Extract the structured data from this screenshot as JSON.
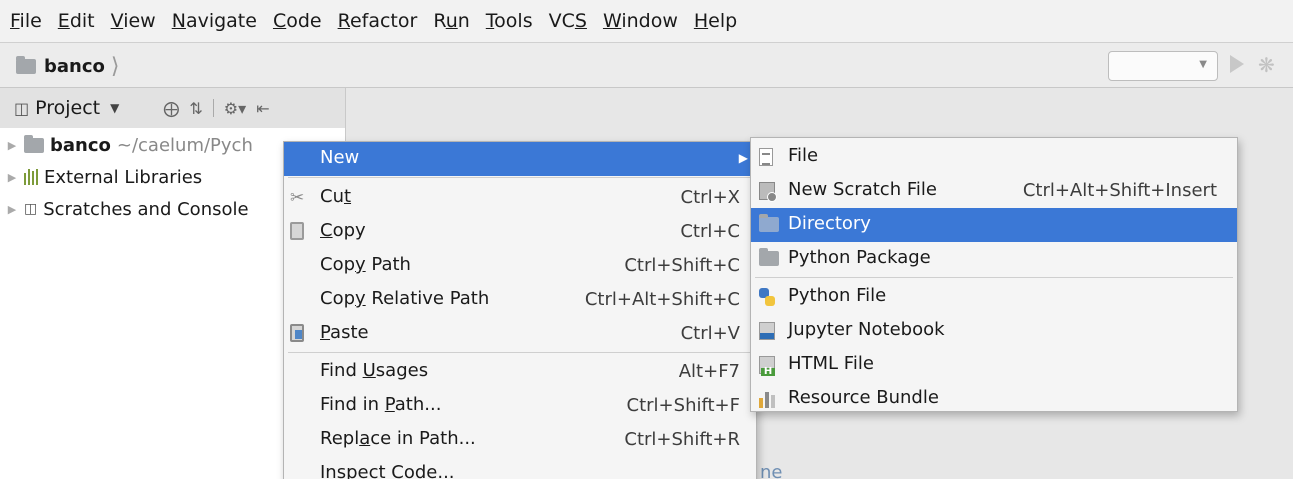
{
  "menubar": {
    "items": [
      {
        "pre": "",
        "u": "F",
        "post": "ile"
      },
      {
        "pre": "",
        "u": "E",
        "post": "dit"
      },
      {
        "pre": "",
        "u": "V",
        "post": "iew"
      },
      {
        "pre": "",
        "u": "N",
        "post": "avigate"
      },
      {
        "pre": "",
        "u": "C",
        "post": "ode"
      },
      {
        "pre": "",
        "u": "R",
        "post": "efactor"
      },
      {
        "pre": "R",
        "u": "u",
        "post": "n"
      },
      {
        "pre": "",
        "u": "T",
        "post": "ools"
      },
      {
        "pre": "VC",
        "u": "S",
        "post": ""
      },
      {
        "pre": "",
        "u": "W",
        "post": "indow"
      },
      {
        "pre": "",
        "u": "H",
        "post": "elp"
      }
    ]
  },
  "navbar": {
    "breadcrumb": "banco"
  },
  "project_panel": {
    "title": "Project",
    "tree": [
      {
        "name": "banco",
        "path": "~/caelum/Pych",
        "icon": "folder-icon"
      },
      {
        "name": "External Libraries",
        "icon": "libraries-icon"
      },
      {
        "name": "Scratches and Console",
        "icon": "scratches-icon"
      }
    ]
  },
  "editor": {
    "hint_fragment": "ne"
  },
  "context_menu": {
    "items": [
      {
        "pre": "",
        "u": "",
        "post": "New",
        "shortcut": "",
        "icon": "",
        "selected": true
      },
      {
        "pre": "Cu",
        "u": "t",
        "post": "",
        "shortcut": "Ctrl+X",
        "icon": "scissors-icon"
      },
      {
        "pre": "",
        "u": "C",
        "post": "opy",
        "shortcut": "Ctrl+C",
        "icon": "copy-icon"
      },
      {
        "pre": "Cop",
        "u": "y",
        "post": " Path",
        "shortcut": "Ctrl+Shift+C",
        "icon": ""
      },
      {
        "pre": "Cop",
        "u": "y",
        "post": " Relative Path",
        "shortcut": "Ctrl+Alt+Shift+C",
        "icon": ""
      },
      {
        "pre": "",
        "u": "P",
        "post": "aste",
        "shortcut": "Ctrl+V",
        "icon": "paste-icon"
      },
      {
        "pre": "Find ",
        "u": "U",
        "post": "sages",
        "shortcut": "Alt+F7",
        "icon": ""
      },
      {
        "pre": "Find in ",
        "u": "P",
        "post": "ath...",
        "shortcut": "Ctrl+Shift+F",
        "icon": ""
      },
      {
        "pre": "Repl",
        "u": "a",
        "post": "ce in Path...",
        "shortcut": "Ctrl+Shift+R",
        "icon": ""
      },
      {
        "pre": "Inspect Code...",
        "u": "",
        "post": "",
        "shortcut": "",
        "icon": ""
      }
    ]
  },
  "submenu": {
    "items": [
      {
        "label": "File",
        "shortcut": "",
        "icon": "file-icon"
      },
      {
        "label": "New Scratch File",
        "shortcut": "Ctrl+Alt+Shift+Insert",
        "icon": "scratch-file-icon"
      },
      {
        "label": "Directory",
        "shortcut": "",
        "icon": "folder-icon",
        "selected": true
      },
      {
        "label": "Python Package",
        "shortcut": "",
        "icon": "package-icon"
      },
      {
        "label": "Python File",
        "shortcut": "",
        "icon": "python-icon"
      },
      {
        "label": "Jupyter Notebook",
        "shortcut": "",
        "icon": "notebook-icon"
      },
      {
        "label": "HTML File",
        "shortcut": "",
        "icon": "html-icon"
      },
      {
        "label": "Resource Bundle",
        "shortcut": "",
        "icon": "resource-bundle-icon"
      }
    ]
  }
}
